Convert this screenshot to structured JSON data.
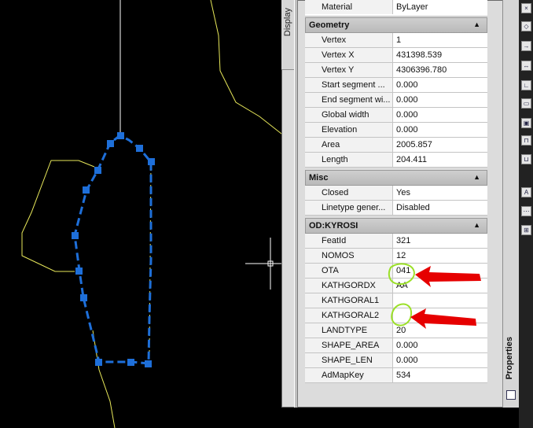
{
  "panel": {
    "display_tab": "Display",
    "right_tab": "Properties",
    "top_row": {
      "key": "Material",
      "value": "ByLayer"
    },
    "sections": [
      {
        "title": "Geometry",
        "rows": [
          {
            "key": "Vertex",
            "value": "1"
          },
          {
            "key": "Vertex X",
            "value": "431398.539"
          },
          {
            "key": "Vertex Y",
            "value": "4306396.780"
          },
          {
            "key": "Start segment ...",
            "value": "0.000"
          },
          {
            "key": "End segment wi...",
            "value": "0.000"
          },
          {
            "key": "Global width",
            "value": "0.000"
          },
          {
            "key": "Elevation",
            "value": "0.000"
          },
          {
            "key": "Area",
            "value": "2005.857"
          },
          {
            "key": "Length",
            "value": "204.411"
          }
        ]
      },
      {
        "title": "Misc",
        "rows": [
          {
            "key": "Closed",
            "value": "Yes"
          },
          {
            "key": "Linetype gener...",
            "value": "Disabled"
          }
        ]
      },
      {
        "title": "OD:KYROSI",
        "rows": [
          {
            "key": "FeatId",
            "value": "321"
          },
          {
            "key": "NOMOS",
            "value": "12"
          },
          {
            "key": "OTA",
            "value": "041"
          },
          {
            "key": "KATHGORDX",
            "value": "AA"
          },
          {
            "key": "KATHGORAL1",
            "value": ""
          },
          {
            "key": "KATHGORAL2",
            "value": ""
          },
          {
            "key": "LANDTYPE",
            "value": "20"
          },
          {
            "key": "SHAPE_AREA",
            "value": "0.000"
          },
          {
            "key": "SHAPE_LEN",
            "value": "0.000"
          },
          {
            "key": "AdMapKey",
            "value": "534"
          }
        ]
      }
    ]
  },
  "colors": {
    "background": "#000000",
    "polyline": "#1e6fd9",
    "boundary": "#e8e85a",
    "marker": "#00cc00",
    "arrow": "#ee0000"
  }
}
